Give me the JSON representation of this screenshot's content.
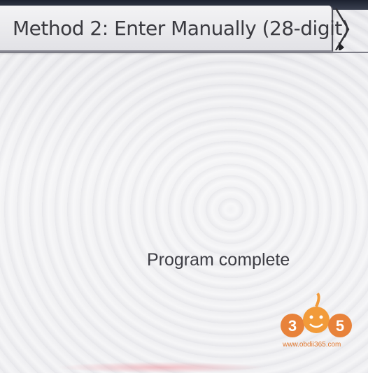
{
  "tab": {
    "title": "Method 2: Enter Manually (28-digit)",
    "arrow_icon": "chevron-right-icon"
  },
  "content": {
    "status": "Program complete"
  },
  "watermark": {
    "logo_text": "365",
    "url": "www.obdii365.com",
    "color": "#e0762b"
  }
}
